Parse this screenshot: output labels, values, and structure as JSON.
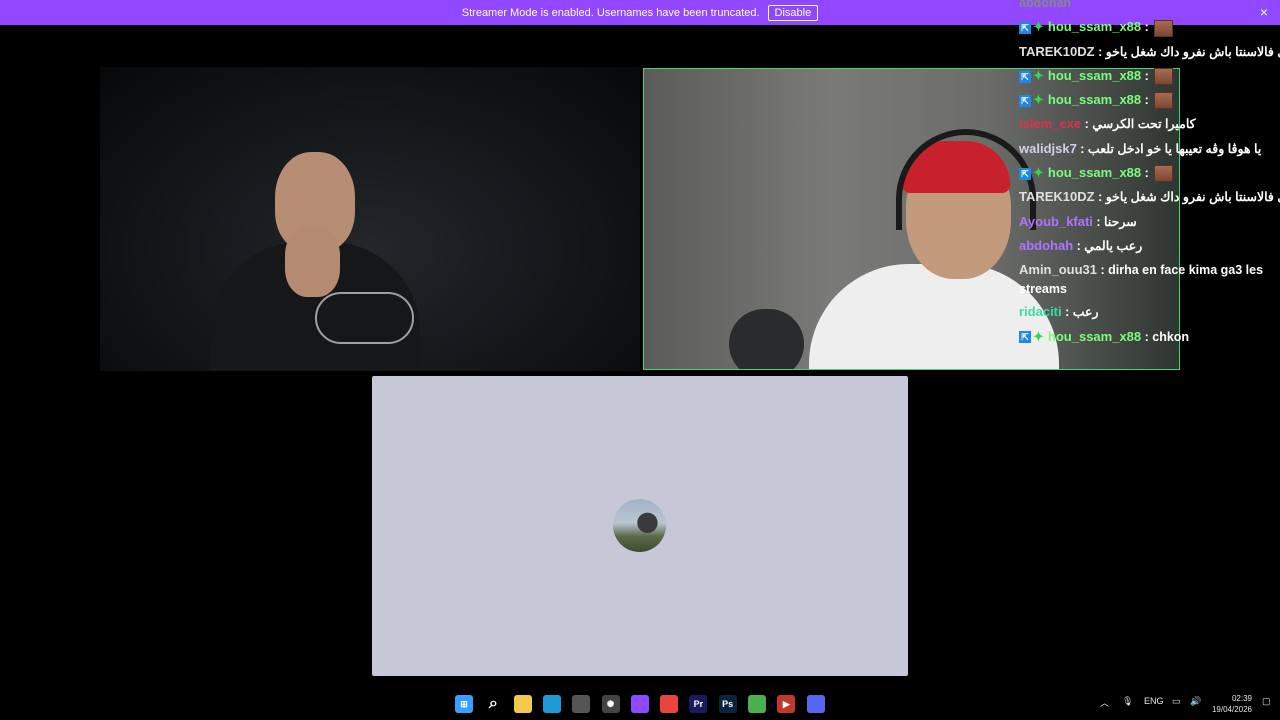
{
  "banner": {
    "text": "Streamer Mode is enabled. Usernames have been truncated.",
    "button_label": "Disable",
    "close_icon": "×"
  },
  "chat": {
    "top_partial": "abdohah",
    "messages": [
      {
        "user": "hou_ssam_x88",
        "color": "#7cfc7c",
        "badges": true,
        "text": "",
        "emote": true
      },
      {
        "user": "TAREK10DZ",
        "color": "#e0e0e0",
        "badges": false,
        "text": "اكسيبيتي فالاسنتا باش نفرو داك شغل ياخو",
        "emote": false
      },
      {
        "user": "hou_ssam_x88",
        "color": "#7cfc7c",
        "badges": true,
        "text": "",
        "emote": true
      },
      {
        "user": "hou_ssam_x88",
        "color": "#7cfc7c",
        "badges": true,
        "text": "",
        "emote": true
      },
      {
        "user": "islem_exe",
        "color": "#e0304a",
        "badges": false,
        "text": "كاميرا تحت الكرسي",
        "emote": false
      },
      {
        "user": "walidjsk7",
        "color": "#d0d0e8",
        "badges": false,
        "text": "يا هوڨا وڨه تعيبها يا خو ادخل تلعب",
        "emote": false
      },
      {
        "user": "hou_ssam_x88",
        "color": "#7cfc7c",
        "badges": true,
        "text": "",
        "emote": true
      },
      {
        "user": "TAREK10DZ",
        "color": "#e0e0e0",
        "badges": false,
        "text": "اكسيبيتي فالاسنتا باش نفرو داك شغل ياخو",
        "emote": false
      },
      {
        "user": "Ayoub_kfati",
        "color": "#b073ff",
        "badges": false,
        "text": "سرحنا",
        "emote": false
      },
      {
        "user": "abdohah",
        "color": "#b073ff",
        "badges": false,
        "text": "رعب يالمي",
        "emote": false
      },
      {
        "user": "Amin_ouu31",
        "color": "#e0e0e0",
        "badges": false,
        "text": "dirha en face kima ga3 les streams",
        "emote": false,
        "wrap": true
      },
      {
        "user": "ridaciti",
        "color": "#3fd9a6",
        "badges": false,
        "text": "رعب",
        "emote": false
      },
      {
        "user": "hou_ssam_x88",
        "color": "#7cfc7c",
        "badges": true,
        "text": "chkon",
        "emote": false
      }
    ]
  },
  "taskbar": {
    "icons": [
      {
        "name": "windows-start-icon",
        "color": "#3aa0ff",
        "glyph": "⊞"
      },
      {
        "name": "search-icon",
        "color": "transparent",
        "glyph": "⌕"
      },
      {
        "name": "file-explorer-icon",
        "color": "#f2c94c",
        "glyph": ""
      },
      {
        "name": "edge-browser-icon",
        "color": "#1e9bd7",
        "glyph": ""
      },
      {
        "name": "store-icon",
        "color": "#555",
        "glyph": ""
      },
      {
        "name": "chatgpt-icon",
        "color": "#444",
        "glyph": "✺"
      },
      {
        "name": "twitch-icon",
        "color": "#9147ff",
        "glyph": ""
      },
      {
        "name": "chrome-icon",
        "color": "#e8453c",
        "glyph": ""
      },
      {
        "name": "premiere-pro-icon",
        "color": "#1b1a5e",
        "glyph": "Pr"
      },
      {
        "name": "photoshop-icon",
        "color": "#0b2240",
        "glyph": "Ps"
      },
      {
        "name": "utorrent-icon",
        "color": "#4cae4c",
        "glyph": ""
      },
      {
        "name": "media-player-icon",
        "color": "#c0392b",
        "glyph": "▶"
      },
      {
        "name": "discord-icon",
        "color": "#5865f2",
        "glyph": ""
      }
    ],
    "lang": "ENG",
    "time": "02:39",
    "date": "19/04/2026"
  }
}
